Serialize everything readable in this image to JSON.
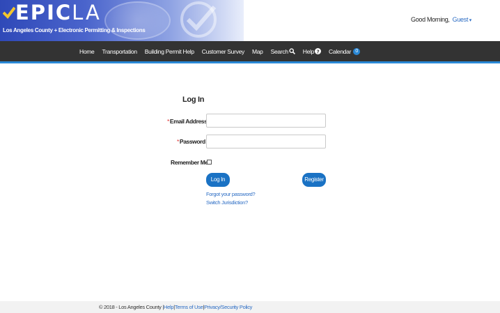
{
  "header": {
    "logo_main": "EPIC",
    "logo_accent": "LA",
    "tagline": "Los Angeles County + Electronic Permitting & Inspections",
    "greeting": "Good Morning,",
    "user": "Guest"
  },
  "nav": {
    "items": [
      {
        "label": "Home"
      },
      {
        "label": "Transportation"
      },
      {
        "label": "Building Permit Help"
      },
      {
        "label": "Customer Survey"
      },
      {
        "label": "Map"
      },
      {
        "label": "Search",
        "icon": "search-icon"
      },
      {
        "label": "Help",
        "icon": "help-icon"
      },
      {
        "label": "Calendar",
        "badge": "0"
      }
    ]
  },
  "login": {
    "title": "Log In",
    "email_label": "Email Address",
    "password_label": "Password",
    "required_marker": "*",
    "remember_label": "Remember Me",
    "login_button": "Log In",
    "register_button": "Register",
    "forgot_link": "Forgot your password?",
    "switch_link": "Switch Jurisdiction?"
  },
  "footer": {
    "copyright": "© 2018 - Los Angeles County",
    "help": "Help",
    "terms": "Terms of Use",
    "privacy": "Privacy/Security Policy"
  },
  "colors": {
    "nav_bg": "#333333",
    "accent": "#2a88d6",
    "button": "#1a72c4",
    "link": "#2b6cc4",
    "required": "#e03030"
  }
}
